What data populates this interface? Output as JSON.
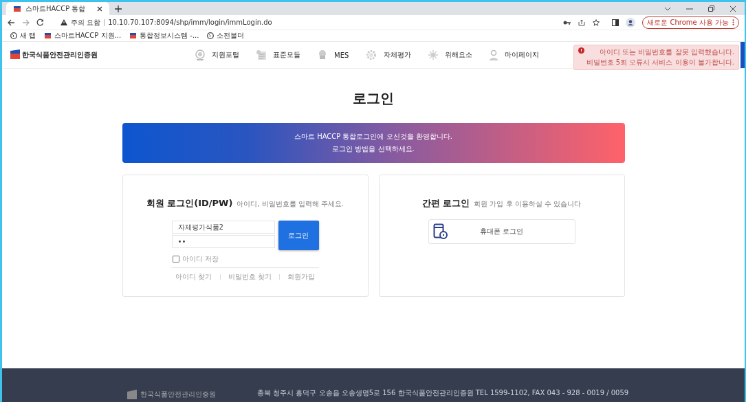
{
  "browser": {
    "tab": {
      "title": "스마트HACCP 통합",
      "selected": true
    },
    "warning": "주의 요함",
    "url": "10.10.70.107:8094/shp/imm/login/immLogin.do",
    "update_button": "새로운 Chrome 사용 가능",
    "bookmarks": [
      {
        "kind": "globe",
        "label": "새 탭"
      },
      {
        "kind": "flag",
        "label": "스마트HACCP 지원..."
      },
      {
        "kind": "flag",
        "label": "통합정보시스템 -..."
      },
      {
        "kind": "globe",
        "label": "소전볼더"
      }
    ]
  },
  "header": {
    "logo": "한국식품안전관리인증원",
    "nav": [
      {
        "kind": "portal",
        "label": "지원포털"
      },
      {
        "kind": "module",
        "label": "표준모듈"
      },
      {
        "kind": "cloud",
        "label": "MES"
      },
      {
        "kind": "gear",
        "label": "자체평가"
      },
      {
        "kind": "hazard",
        "label": "위해요소"
      },
      {
        "kind": "person",
        "label": "마이페이지"
      }
    ]
  },
  "alert": {
    "lines": [
      "아이디 또는 비밀번호를 잘못 입력했습니다.",
      "비밀번호 5회 오류시 서비스 이용이 불가합니다."
    ]
  },
  "title": "로그인",
  "banner": [
    "스마트 HACCP 통합로그인에 오신것을 환영합니다.",
    "로그인 방법을 선택하세요."
  ],
  "member_login": {
    "heading": "회원 로그인(ID/PW)",
    "hint": "아이디, 비밀번호를 입력해 주세요.",
    "id_value": "자체평가식품2",
    "password_value": "••",
    "button": "로그인",
    "remember": {
      "label": "아이디 저장",
      "checked": false
    },
    "links": [
      "아이디 찾기",
      "비밀번호 찾기",
      "회원가입"
    ]
  },
  "simple_login": {
    "heading": "간편 로그인",
    "hint": "회원 가입 후 이용하실 수 있습니다",
    "button": "휴대폰 로그인"
  },
  "footer": {
    "org": "한국식품안전관리인증원",
    "address": "충북 청주시 흥덕구 오송읍 오송생명5로 156 한국식품안전관리인증원 TEL 1599-1102, FAX 043 - 928 - 0019 / 0059"
  }
}
